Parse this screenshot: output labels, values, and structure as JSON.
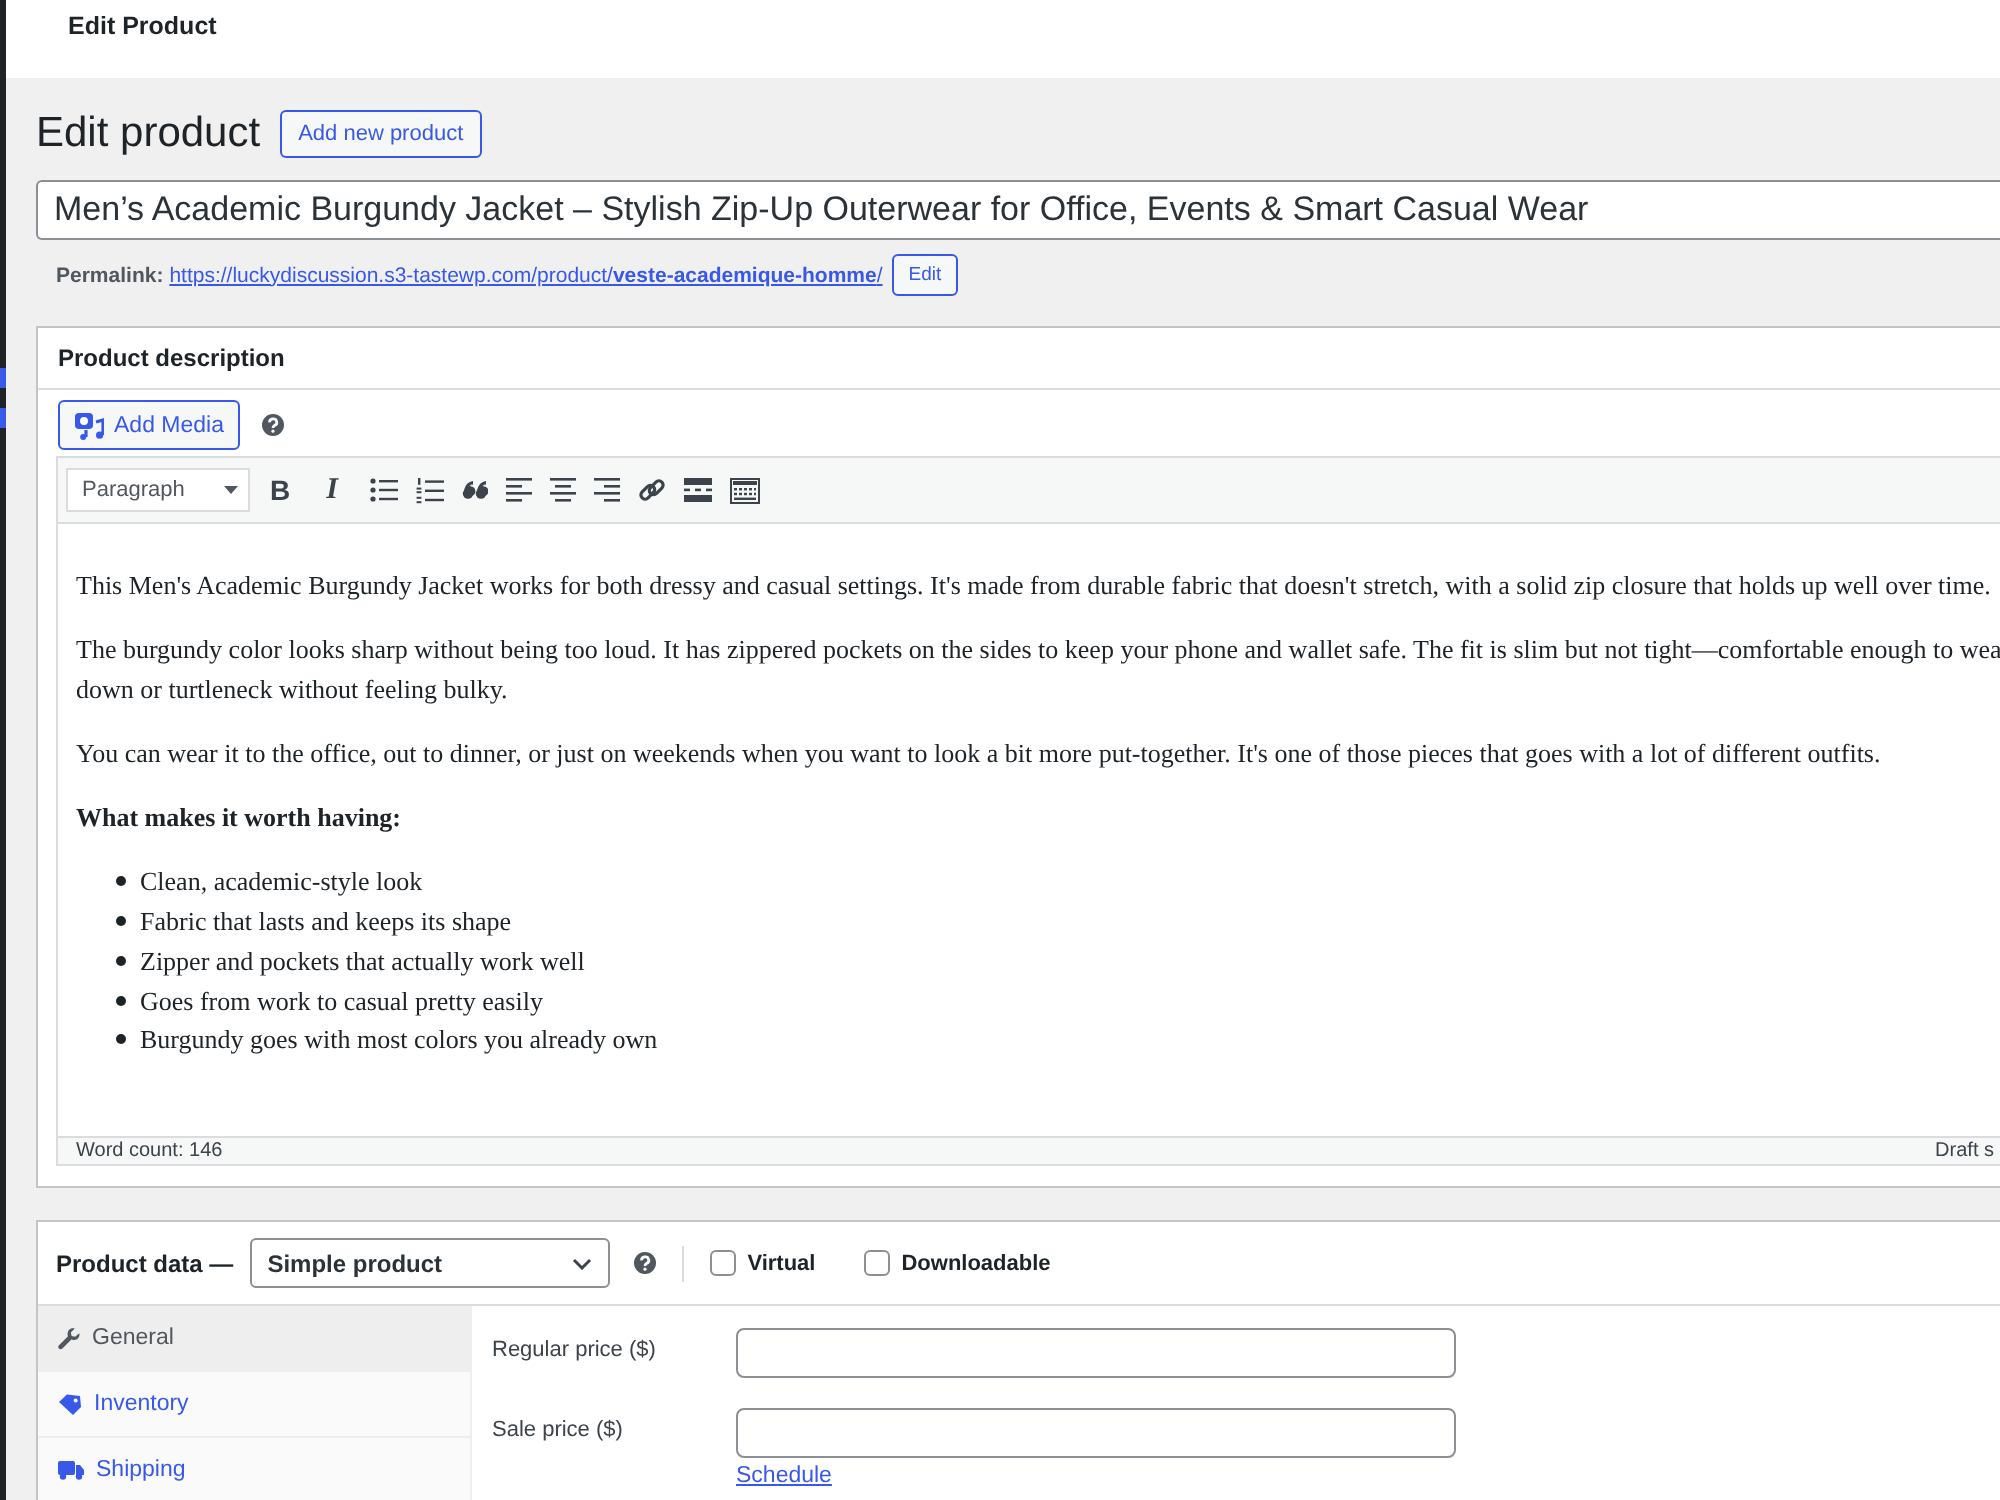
{
  "top_bar": {
    "title": "Edit Product"
  },
  "heading": {
    "title": "Edit product",
    "add_button": "Add new product"
  },
  "title_field": {
    "value": "Men’s Academic Burgundy Jacket – Stylish Zip-Up Outerwear for Office, Events & Smart Casual Wear"
  },
  "permalink": {
    "label": "Permalink:",
    "url": "https://luckydiscussion.s3-tastewp.com/product/**veste-academique-homme**/",
    "edit_button": "Edit"
  },
  "description": {
    "title": "Product description",
    "add_media": "Add Media",
    "toolbar": {
      "format": "Paragraph",
      "bold": "B",
      "italic": "I"
    },
    "content": [
      {
        "kind": "paragraph",
        "lines": [
          "This Men's Academic Burgundy Jacket works for both dressy and casual settings. It's made from durable fabric that doesn't stretch, with a solid zip closure that holds up well over time."
        ]
      },
      {
        "kind": "paragraph",
        "lines": [
          "The burgundy color looks sharp without being too loud. It has zippered pockets on the sides to keep your phone and wallet safe. The fit is slim but not tight—comfortable enough to wea",
          "down or turtleneck without feeling bulky."
        ]
      },
      {
        "kind": "paragraph",
        "lines": [
          "You can wear it to the office, out to dinner, or just on weekends when you want to look a bit more put-together. It's one of those pieces that goes with a lot of different outfits."
        ]
      },
      {
        "kind": "heading",
        "text": "What makes it worth having:"
      },
      {
        "kind": "list",
        "items": [
          "Clean, academic-style look",
          "Fabric that lasts and keeps its shape",
          "Zipper and pockets that actually work well",
          "Goes from work to casual pretty easily",
          "Burgundy goes with most colors you already own"
        ]
      }
    ],
    "word_count": "Word count: 146",
    "status": "Draft s"
  },
  "product_data": {
    "title": "Product data —",
    "type": "Simple product",
    "options": [
      {
        "label": "Virtual",
        "checked": false
      },
      {
        "label": "Downloadable",
        "checked": false
      }
    ],
    "tabs": [
      {
        "label": "General",
        "selected": true
      },
      {
        "label": "Inventory",
        "selected": false
      },
      {
        "label": "Shipping",
        "selected": false
      }
    ],
    "fields": [
      {
        "label": "Regular price ($)"
      },
      {
        "label": "Sale price ($)",
        "link": "Schedule"
      }
    ]
  }
}
